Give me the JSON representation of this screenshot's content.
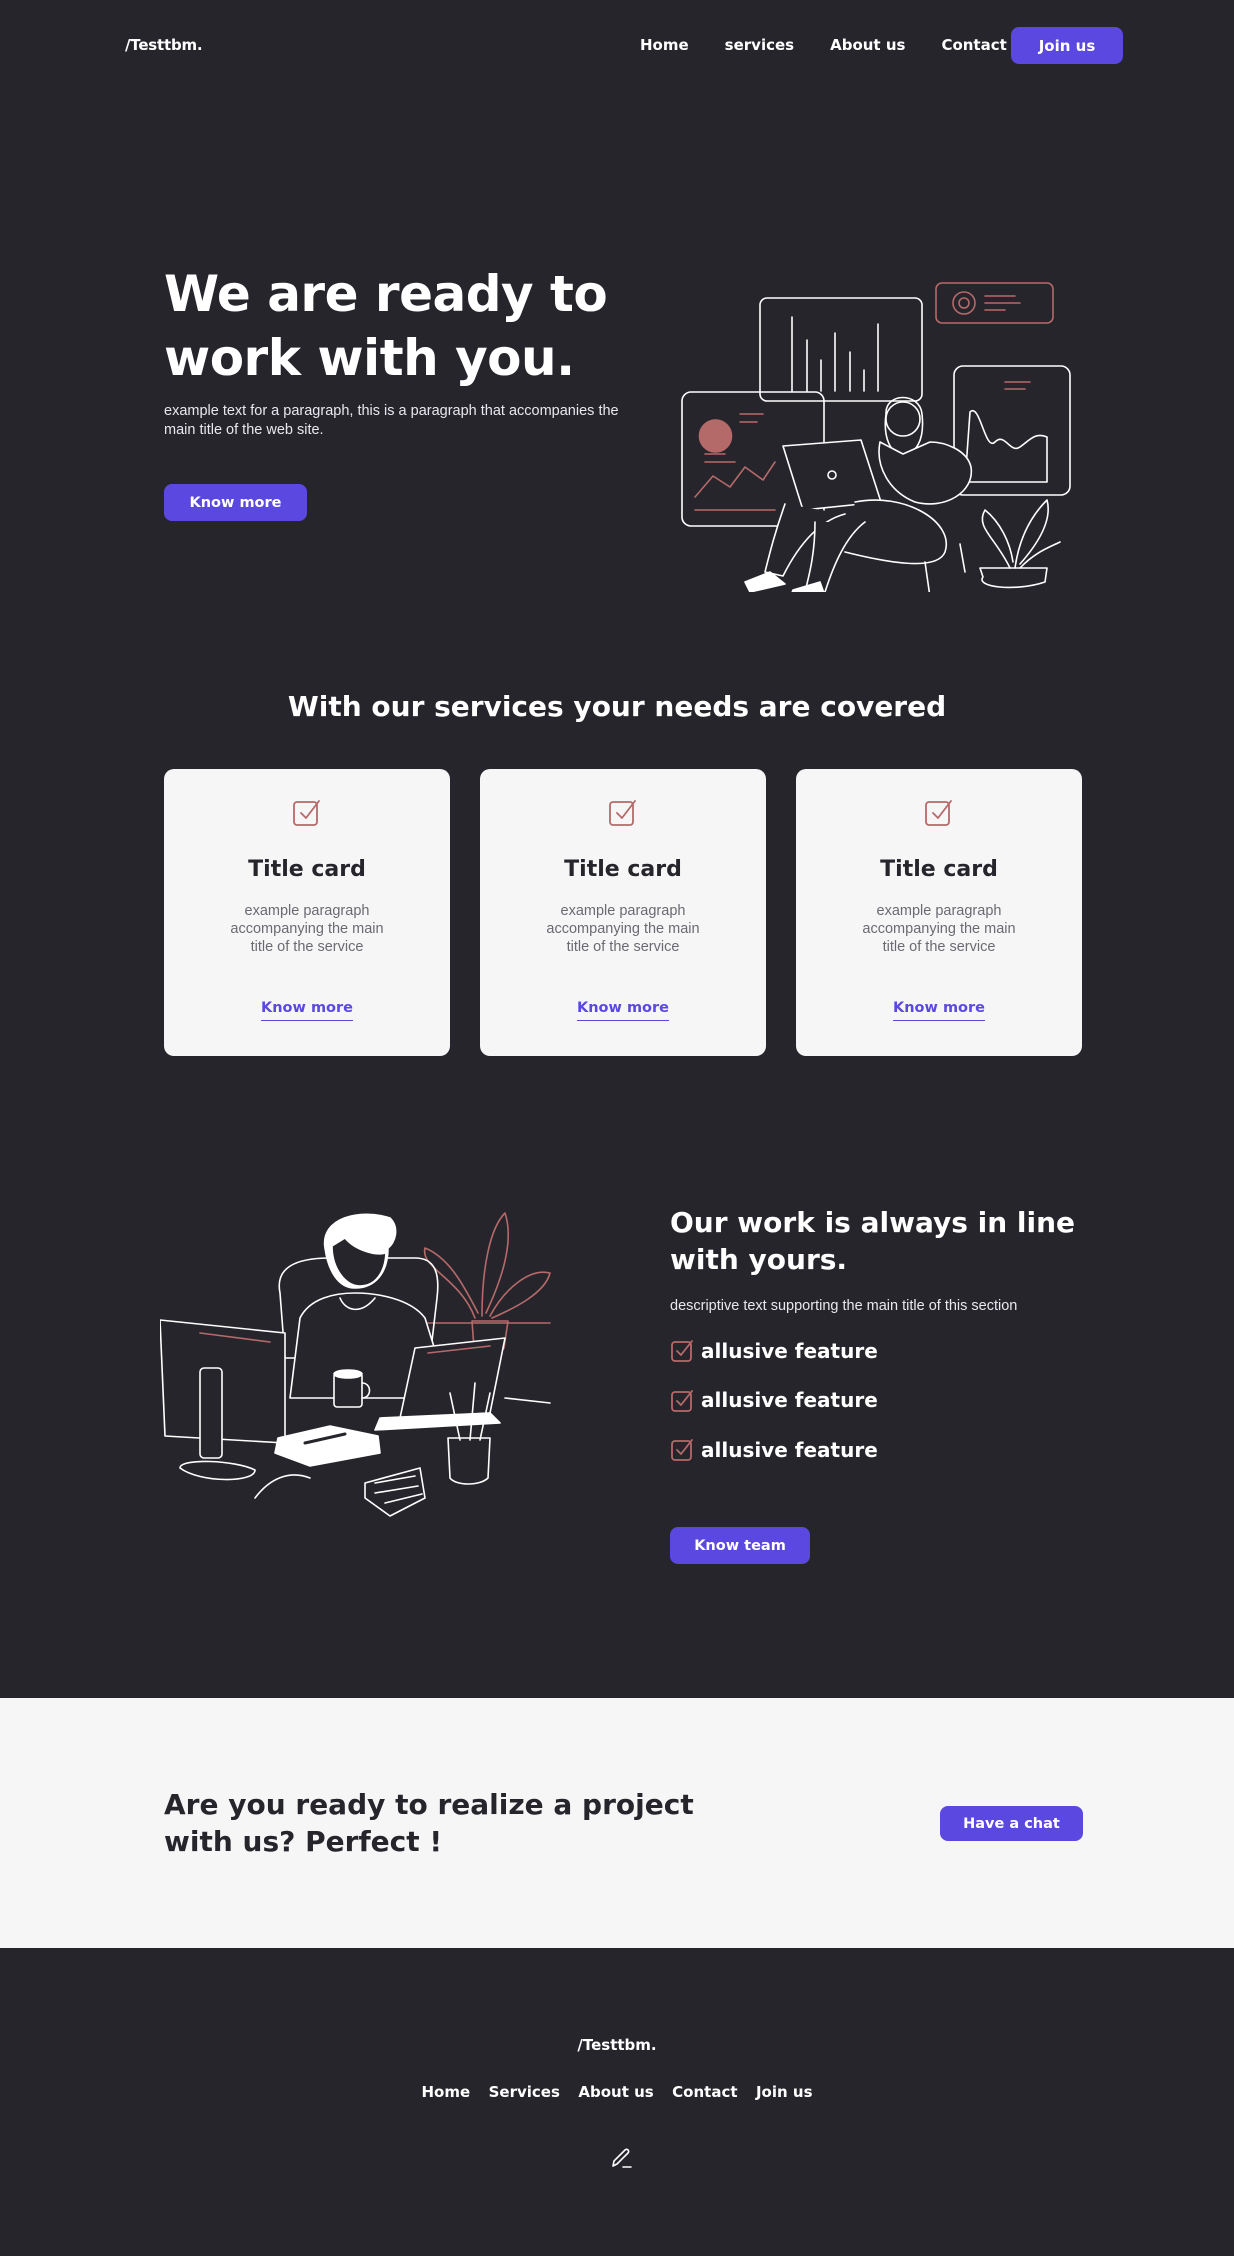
{
  "nav": {
    "logo": "/Testtbm.",
    "links": [
      "Home",
      "services",
      "About us",
      "Contact"
    ],
    "join_label": "Join us"
  },
  "hero": {
    "title": "We are ready to work with you.",
    "text": "example text for a paragraph, this is a paragraph that accompanies the main title of the web site.",
    "button_label": "Know more"
  },
  "services": {
    "title": "With our services your needs are covered",
    "cards": [
      {
        "title": "Title card",
        "text": "example paragraph accompanying the main title of the service",
        "link": "Know more"
      },
      {
        "title": "Title card",
        "text": "example paragraph accompanying the main title of the service",
        "link": "Know more"
      },
      {
        "title": "Title card",
        "text": "example paragraph accompanying the main title of the service",
        "link": "Know more"
      }
    ]
  },
  "work": {
    "title": "Our work is always in line with yours.",
    "text": "descriptive text supporting the main title of this section",
    "features": [
      "allusive feature",
      "allusive feature",
      "allusive feature"
    ],
    "button_label": "Know team"
  },
  "cta": {
    "title": "Are you ready to realize a project with us? Perfect !",
    "button_label": "Have a chat"
  },
  "footer": {
    "logo": "/Testtbm.",
    "links": [
      "Home",
      "Services",
      "About us",
      "Contact",
      "Join us"
    ],
    "icon": "pencil-icon"
  },
  "colors": {
    "background": "#26252c",
    "accent": "#5b48e0",
    "light": "#f6f6f7",
    "illustration_accent": "#b56a6a"
  }
}
